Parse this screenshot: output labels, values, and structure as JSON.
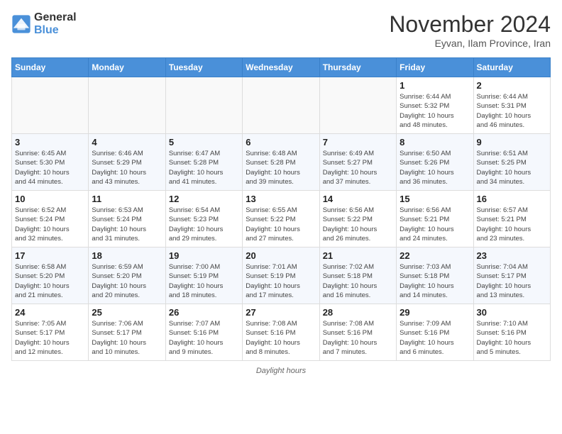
{
  "logo": {
    "general": "General",
    "blue": "Blue"
  },
  "title": "November 2024",
  "subtitle": "Eyvan, Ilam Province, Iran",
  "days_of_week": [
    "Sunday",
    "Monday",
    "Tuesday",
    "Wednesday",
    "Thursday",
    "Friday",
    "Saturday"
  ],
  "footer": "Daylight hours",
  "weeks": [
    [
      {
        "day": "",
        "info": ""
      },
      {
        "day": "",
        "info": ""
      },
      {
        "day": "",
        "info": ""
      },
      {
        "day": "",
        "info": ""
      },
      {
        "day": "",
        "info": ""
      },
      {
        "day": "1",
        "info": "Sunrise: 6:44 AM\nSunset: 5:32 PM\nDaylight: 10 hours\nand 48 minutes."
      },
      {
        "day": "2",
        "info": "Sunrise: 6:44 AM\nSunset: 5:31 PM\nDaylight: 10 hours\nand 46 minutes."
      }
    ],
    [
      {
        "day": "3",
        "info": "Sunrise: 6:45 AM\nSunset: 5:30 PM\nDaylight: 10 hours\nand 44 minutes."
      },
      {
        "day": "4",
        "info": "Sunrise: 6:46 AM\nSunset: 5:29 PM\nDaylight: 10 hours\nand 43 minutes."
      },
      {
        "day": "5",
        "info": "Sunrise: 6:47 AM\nSunset: 5:28 PM\nDaylight: 10 hours\nand 41 minutes."
      },
      {
        "day": "6",
        "info": "Sunrise: 6:48 AM\nSunset: 5:28 PM\nDaylight: 10 hours\nand 39 minutes."
      },
      {
        "day": "7",
        "info": "Sunrise: 6:49 AM\nSunset: 5:27 PM\nDaylight: 10 hours\nand 37 minutes."
      },
      {
        "day": "8",
        "info": "Sunrise: 6:50 AM\nSunset: 5:26 PM\nDaylight: 10 hours\nand 36 minutes."
      },
      {
        "day": "9",
        "info": "Sunrise: 6:51 AM\nSunset: 5:25 PM\nDaylight: 10 hours\nand 34 minutes."
      }
    ],
    [
      {
        "day": "10",
        "info": "Sunrise: 6:52 AM\nSunset: 5:24 PM\nDaylight: 10 hours\nand 32 minutes."
      },
      {
        "day": "11",
        "info": "Sunrise: 6:53 AM\nSunset: 5:24 PM\nDaylight: 10 hours\nand 31 minutes."
      },
      {
        "day": "12",
        "info": "Sunrise: 6:54 AM\nSunset: 5:23 PM\nDaylight: 10 hours\nand 29 minutes."
      },
      {
        "day": "13",
        "info": "Sunrise: 6:55 AM\nSunset: 5:22 PM\nDaylight: 10 hours\nand 27 minutes."
      },
      {
        "day": "14",
        "info": "Sunrise: 6:56 AM\nSunset: 5:22 PM\nDaylight: 10 hours\nand 26 minutes."
      },
      {
        "day": "15",
        "info": "Sunrise: 6:56 AM\nSunset: 5:21 PM\nDaylight: 10 hours\nand 24 minutes."
      },
      {
        "day": "16",
        "info": "Sunrise: 6:57 AM\nSunset: 5:21 PM\nDaylight: 10 hours\nand 23 minutes."
      }
    ],
    [
      {
        "day": "17",
        "info": "Sunrise: 6:58 AM\nSunset: 5:20 PM\nDaylight: 10 hours\nand 21 minutes."
      },
      {
        "day": "18",
        "info": "Sunrise: 6:59 AM\nSunset: 5:20 PM\nDaylight: 10 hours\nand 20 minutes."
      },
      {
        "day": "19",
        "info": "Sunrise: 7:00 AM\nSunset: 5:19 PM\nDaylight: 10 hours\nand 18 minutes."
      },
      {
        "day": "20",
        "info": "Sunrise: 7:01 AM\nSunset: 5:19 PM\nDaylight: 10 hours\nand 17 minutes."
      },
      {
        "day": "21",
        "info": "Sunrise: 7:02 AM\nSunset: 5:18 PM\nDaylight: 10 hours\nand 16 minutes."
      },
      {
        "day": "22",
        "info": "Sunrise: 7:03 AM\nSunset: 5:18 PM\nDaylight: 10 hours\nand 14 minutes."
      },
      {
        "day": "23",
        "info": "Sunrise: 7:04 AM\nSunset: 5:17 PM\nDaylight: 10 hours\nand 13 minutes."
      }
    ],
    [
      {
        "day": "24",
        "info": "Sunrise: 7:05 AM\nSunset: 5:17 PM\nDaylight: 10 hours\nand 12 minutes."
      },
      {
        "day": "25",
        "info": "Sunrise: 7:06 AM\nSunset: 5:17 PM\nDaylight: 10 hours\nand 10 minutes."
      },
      {
        "day": "26",
        "info": "Sunrise: 7:07 AM\nSunset: 5:16 PM\nDaylight: 10 hours\nand 9 minutes."
      },
      {
        "day": "27",
        "info": "Sunrise: 7:08 AM\nSunset: 5:16 PM\nDaylight: 10 hours\nand 8 minutes."
      },
      {
        "day": "28",
        "info": "Sunrise: 7:08 AM\nSunset: 5:16 PM\nDaylight: 10 hours\nand 7 minutes."
      },
      {
        "day": "29",
        "info": "Sunrise: 7:09 AM\nSunset: 5:16 PM\nDaylight: 10 hours\nand 6 minutes."
      },
      {
        "day": "30",
        "info": "Sunrise: 7:10 AM\nSunset: 5:16 PM\nDaylight: 10 hours\nand 5 minutes."
      }
    ]
  ]
}
